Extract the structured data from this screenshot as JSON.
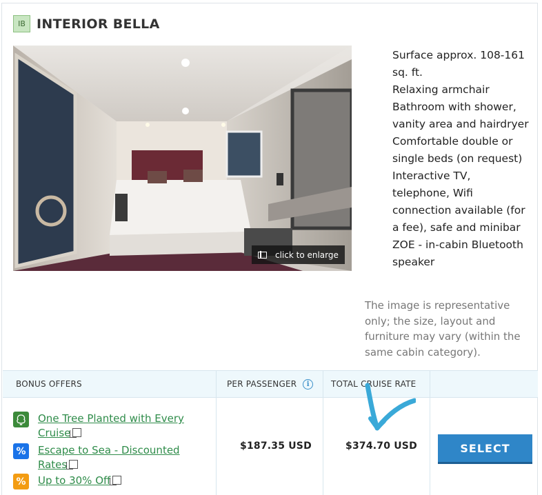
{
  "cabin": {
    "code": "IB",
    "title": "INTERIOR BELLA",
    "photo_overlay": "click to enlarge",
    "features": [
      "Surface approx. 108-161 sq. ft.",
      "Relaxing armchair",
      "Bathroom with shower, vanity area and hairdryer",
      "Comfortable double or single beds (on request)",
      "Interactive TV, telephone, Wifi connection available (for a fee), safe and minibar",
      "ZOE - in-cabin Bluetooth speaker"
    ],
    "disclaimer": "The image is representative only; the size, layout and furniture may vary (within the same cabin category)."
  },
  "table": {
    "headers": {
      "bonus": "BONUS OFFERS",
      "per_passenger": "PER PASSENGER",
      "total": "TOTAL CRUISE RATE"
    },
    "offers": [
      {
        "icon": "tree-icon",
        "color": "#3c8a3a",
        "label": "One Tree Planted with Every Cruise"
      },
      {
        "icon": "percent-icon",
        "color": "#1a73e8",
        "label": "Escape to Sea - Discounted Rates"
      },
      {
        "icon": "percent-icon",
        "color": "#f39c12",
        "label": "Up to 30% Off"
      }
    ],
    "per_passenger": "$187.35 USD",
    "total": "$374.70 USD",
    "select_label": "SELECT"
  },
  "colors": {
    "accent": "#2f86c8",
    "offer_link": "#2f8c4a",
    "header_bg": "#eef8fc",
    "annotation": "#3aa9d8"
  }
}
